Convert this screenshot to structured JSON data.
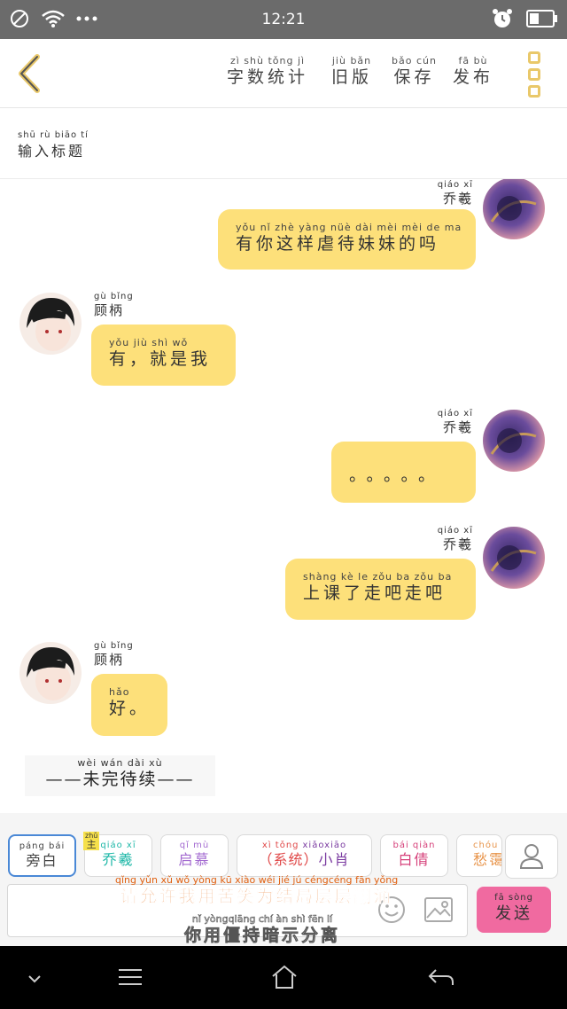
{
  "status_bar": {
    "time": "12:21"
  },
  "toolbar": {
    "tools": [
      {
        "pinyin": "zì shù tǒng jì",
        "label": "字数统计"
      },
      {
        "pinyin": "jiù bǎn",
        "label": "旧版"
      },
      {
        "pinyin": "bǎo cún",
        "label": "保存"
      },
      {
        "pinyin": "fā bù",
        "label": "发布"
      }
    ]
  },
  "title_input": {
    "pinyin": "shū rù biāo tí",
    "placeholder": "输入标题"
  },
  "messages": [
    {
      "side": "right",
      "name_pinyin": "qiáo xī",
      "name": "乔羲",
      "pinyin": "yǒu nǐ zhè yàng nüè dài mèi mèi de ma",
      "text": "有你这样虐待妹妹的吗"
    },
    {
      "side": "left",
      "name_pinyin": "gù bǐng",
      "name": "顾柄",
      "pinyin": "yǒu jiù shì wǒ",
      "text": "有，就是我"
    },
    {
      "side": "right",
      "name_pinyin": "qiáo xī",
      "name": "乔羲",
      "pinyin": "",
      "text": "。。。。。"
    },
    {
      "side": "right",
      "name_pinyin": "qiáo xī",
      "name": "乔羲",
      "pinyin": "shàng kè le zǒu ba zǒu ba",
      "text": "上课了走吧走吧"
    },
    {
      "side": "left",
      "name_pinyin": "gù bǐng",
      "name": "顾柄",
      "pinyin": "hǎo",
      "text": "好。"
    }
  ],
  "to_be_continued": {
    "pinyin": "wèi wán dài xù",
    "text": "——未完待续——"
  },
  "roles": [
    {
      "pinyin": "páng bái",
      "label": "旁白",
      "color": "#444444",
      "active": true
    },
    {
      "pinyin": "qiáo xī",
      "label": "乔羲",
      "color": "#1fb8a8",
      "tag": "主",
      "tag_pinyin": "zhǔ"
    },
    {
      "pinyin": "qǐ mù",
      "label": "启慕",
      "color": "#a36ad0"
    },
    {
      "pinyin_a": "xì tǒng",
      "label_a": "（系统）",
      "pinyin_b": "xiǎoxiāo",
      "label_b": "小肖",
      "color_a": "#e04848",
      "color_b": "#7a3aa0"
    },
    {
      "pinyin": "bái qiàn",
      "label": "白倩",
      "color": "#d6407a"
    },
    {
      "pinyin": "chóu ǎi",
      "label": "愁霭",
      "color": "#e8944a"
    }
  ],
  "send": {
    "pinyin": "fā sòng",
    "label": "发送"
  },
  "captions": [
    {
      "pinyin": "qǐng yǔn xǔ wǒ yòng kū xiào wéi jié jú céngcéng fān yǒng",
      "text": "请允许我用苦笑为结局层层翻涌"
    },
    {
      "pinyin": "nǐ yòngqiāng chí àn shì fēn lí",
      "text": "你用僵持暗示分离"
    }
  ],
  "colors": {
    "accent": "#fde07a",
    "send": "#f06aa0",
    "active_border": "#4a88d6",
    "menu_dots": "#e9c86a"
  }
}
